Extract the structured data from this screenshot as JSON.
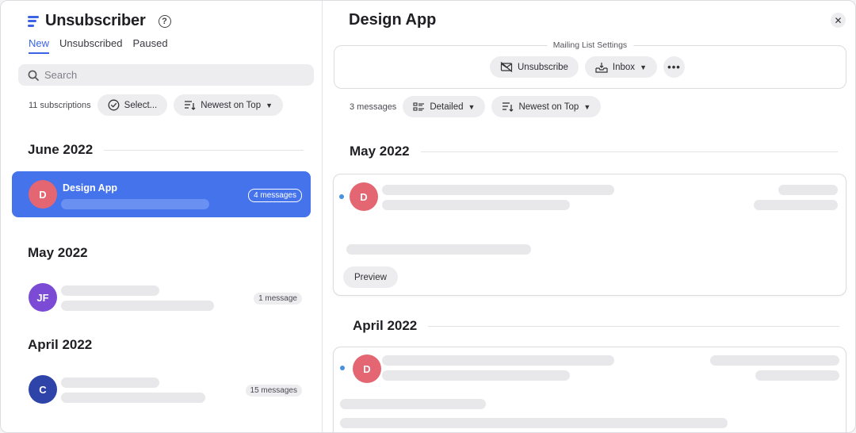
{
  "app": {
    "title": "Unsubscriber",
    "help_glyph": "?"
  },
  "tabs": [
    {
      "label": "New",
      "active": true
    },
    {
      "label": "Unsubscribed",
      "active": false
    },
    {
      "label": "Paused",
      "active": false
    }
  ],
  "search": {
    "placeholder": "Search",
    "value": ""
  },
  "left_filters": {
    "count": "11 subscriptions",
    "select_label": "Select...",
    "sort_label": "Newest on Top"
  },
  "groups": [
    {
      "heading": "June 2022",
      "items": [
        {
          "name": "Design App",
          "initial": "D",
          "avatar_color": "#e46673",
          "badge": "4 messages",
          "selected": true
        }
      ]
    },
    {
      "heading": "May 2022",
      "items": [
        {
          "name": "",
          "initial": "JF",
          "avatar_color": "#7b4bd6",
          "badge": "1 message",
          "selected": false
        }
      ]
    },
    {
      "heading": "April 2022",
      "items": [
        {
          "name": "",
          "initial": "C",
          "avatar_color": "#2e44a8",
          "badge": "15 messages",
          "selected": false
        }
      ]
    }
  ],
  "detail": {
    "title": "Design App",
    "close_glyph": "✕",
    "mailing_list_label": "Mailing List Settings",
    "unsubscribe_label": "Unsubscribe",
    "inbox_label": "Inbox",
    "more_glyph": "•••",
    "message_count": "3 messages",
    "view_label": "Detailed",
    "sort_label": "Newest on Top",
    "groups": [
      {
        "heading": "May 2022",
        "initial": "D",
        "preview_label": "Preview"
      },
      {
        "heading": "April 2022",
        "initial": "D"
      }
    ]
  },
  "colors": {
    "accent": "#3b63e6",
    "selected_row": "#4473ec",
    "unread_dot": "#4a90e2"
  },
  "icons": [
    "list-logo-icon",
    "help-icon",
    "search-icon",
    "check-circle-icon",
    "sort-icon",
    "chevron-down-icon",
    "unsubscribe-mail-icon",
    "inbox-tray-icon",
    "detailed-view-icon",
    "close-icon",
    "more-icon"
  ]
}
